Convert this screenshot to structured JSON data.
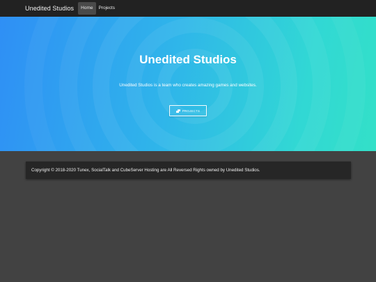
{
  "navbar": {
    "brand": "Unedited Studios",
    "links": [
      {
        "label": "Home",
        "active": true
      },
      {
        "label": "Projects",
        "active": false
      }
    ]
  },
  "hero": {
    "title": "Unedited Studios",
    "subtitle": "Unedited Studios is a team who creates amazing games and websites.",
    "button_label": "PROJECTS",
    "button_icon": "clone-icon"
  },
  "footer": {
    "copyright": "Copyright © 2018-2020 Tunex, SocialTalk and CubeServer Hosting are All Reversed Rights owned by Unedited Studios."
  },
  "colors": {
    "navbar_bg": "#222222",
    "hero_gradient_start": "#2f8ff5",
    "hero_gradient_end": "#33e0c8",
    "page_bg": "#424242",
    "footer_card_bg": "#262626"
  }
}
